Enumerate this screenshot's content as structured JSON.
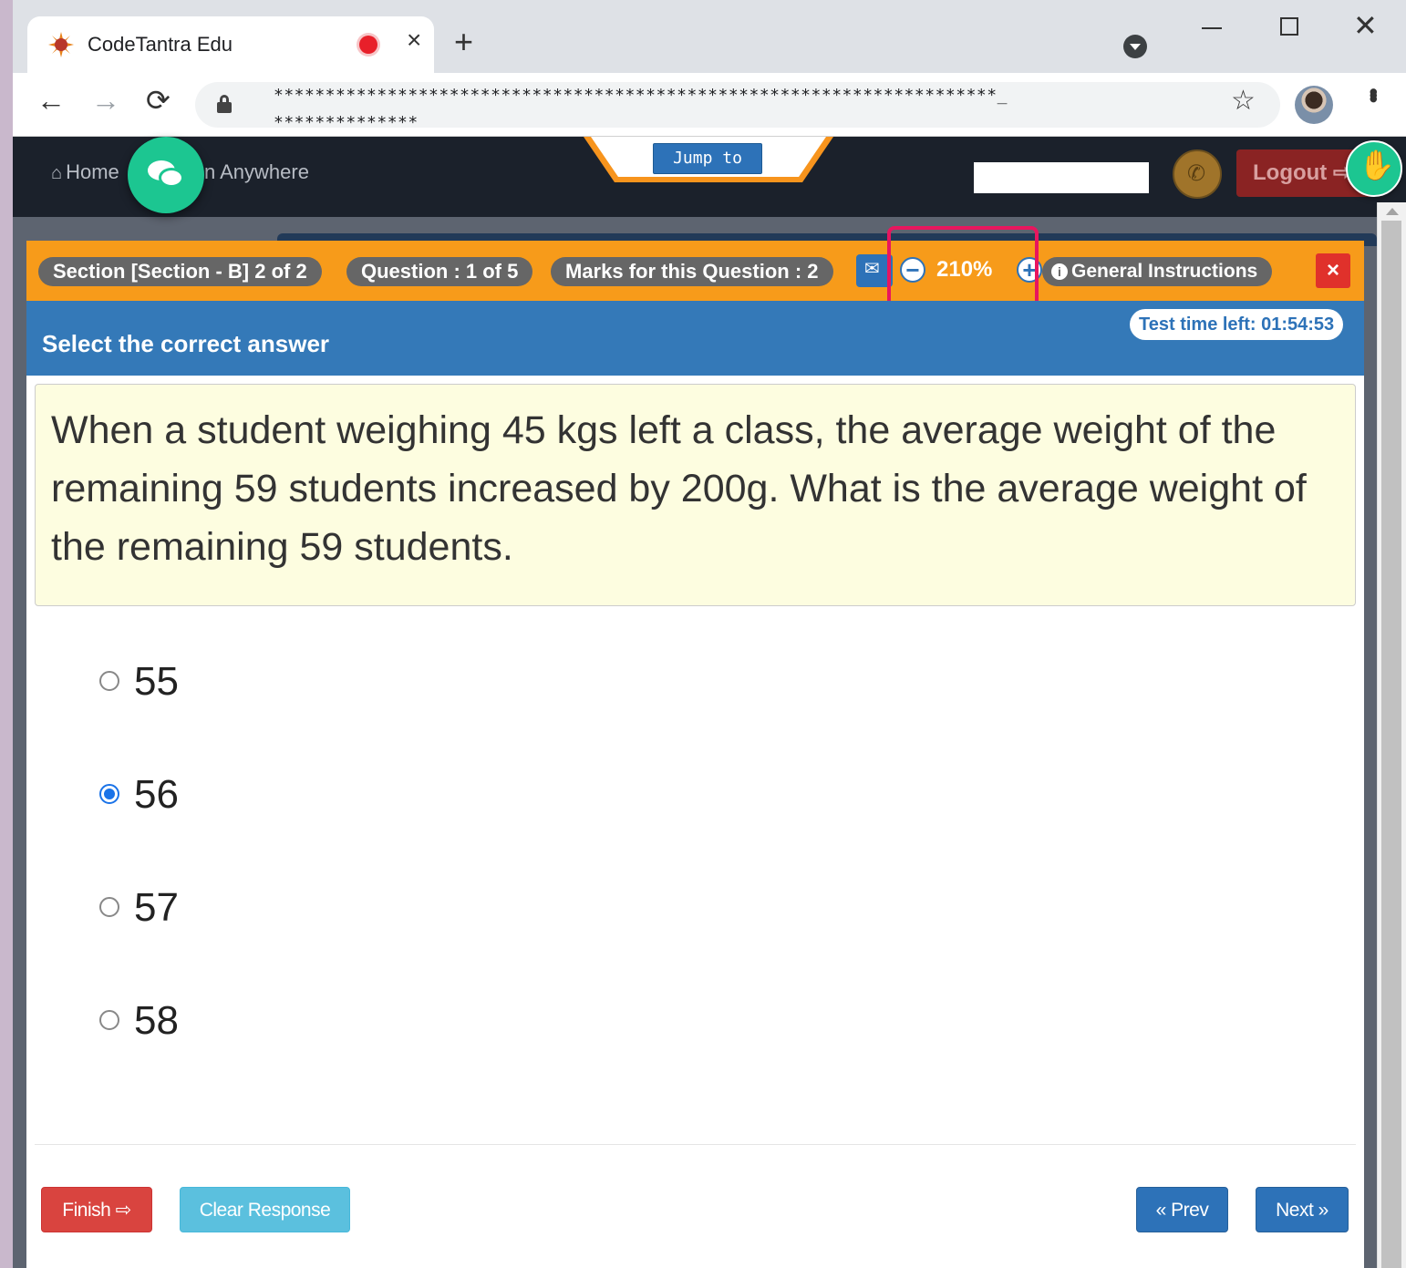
{
  "browser": {
    "tab_title": "CodeTantra Edu",
    "tab_close": "×",
    "new_tab": "+",
    "url_line1": "**********************************************************************_",
    "url_line2": "**************",
    "back": "←",
    "forward": "→",
    "reload": "⟳",
    "star": "☆",
    "min": "",
    "close": "✕"
  },
  "navbar": {
    "home_label": "Home",
    "anywhere_label": "n Anywhere",
    "jump_label": "Jump to",
    "logout_label": "Logout ⇨"
  },
  "question_bar": {
    "section": "Section [Section - B] 2 of 2",
    "question": "Question : 1 of 5",
    "marks": "Marks for this Question : 2",
    "zoom_value": "210%",
    "zoom_minus": "−",
    "zoom_plus": "+",
    "instructions": "General Instructions",
    "close": "×"
  },
  "header": {
    "title": "Select the correct answer",
    "timer": "Test time left: 01:54:53"
  },
  "question": {
    "text": "When a student weighing 45 kgs left a class, the average weight of the remaining 59 students increased by 200g. What is the average weight of the remaining 59 students."
  },
  "options": [
    {
      "label": "55",
      "selected": false
    },
    {
      "label": "56",
      "selected": true
    },
    {
      "label": "57",
      "selected": false
    },
    {
      "label": "58",
      "selected": false
    }
  ],
  "footer": {
    "finish": "Finish ⇨",
    "clear": "Clear Response",
    "prev": "« Prev",
    "next": "Next »"
  },
  "colors": {
    "orange_bar": "#f79b1a",
    "blue_header": "#3479b8",
    "question_bg": "#fdfde0",
    "zoom_highlight": "#e8165e",
    "fab_green": "#1cc691"
  }
}
